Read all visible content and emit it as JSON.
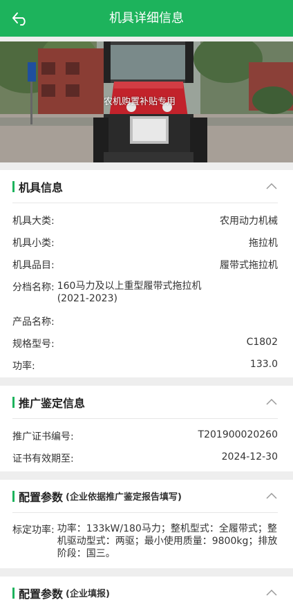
{
  "header": {
    "title": "机具详细信息",
    "back_icon": "back-arrow-icon"
  },
  "banner": {
    "watermark": "农机购置补贴专用",
    "slide_count": 3,
    "active_slide": 1
  },
  "sections": {
    "machine_info": {
      "title": "机具信息",
      "rows": [
        {
          "label": "机具大类:",
          "value": "农用动力机械"
        },
        {
          "label": "机具小类:",
          "value": "拖拉机"
        },
        {
          "label": "机具品目:",
          "value": "履带式拖拉机"
        },
        {
          "label": "分档名称:",
          "value": "160马力及以上重型履带式拖拉机\n(2021-2023)"
        },
        {
          "label": "产品名称:",
          "value": ""
        },
        {
          "label": "规格型号:",
          "value": "C1802"
        },
        {
          "label": "功率:",
          "value": "133.0"
        }
      ]
    },
    "promotion": {
      "title": "推广鉴定信息",
      "rows": [
        {
          "label": "推广证书编号:",
          "value": "T201900020260"
        },
        {
          "label": "证书有效期至:",
          "value": "2024-12-30"
        }
      ]
    },
    "config1": {
      "title": "配置参数",
      "subtitle": "(企业依据推广鉴定报告填写)",
      "rows": [
        {
          "label": "标定功率:",
          "value": "功率：133kW/180马力；整机型式：全履带式；整机驱动型式：两驱；最小使用质量：9800kg；排放阶段：国三。"
        }
      ]
    },
    "config2": {
      "title": "配置参数",
      "subtitle": "(企业填报)"
    }
  },
  "colors": {
    "primary": "#1db35c",
    "indicator_active": "#e0212b"
  }
}
